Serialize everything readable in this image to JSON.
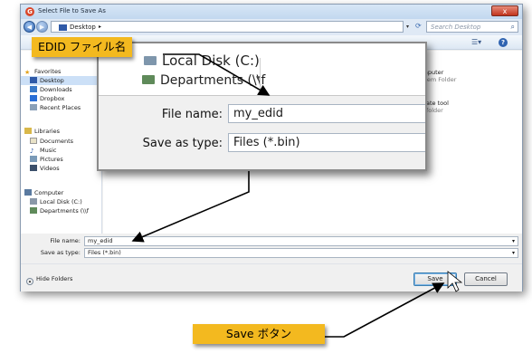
{
  "window": {
    "title": "Select File to Save As",
    "close_glyph": "x",
    "app_icon_glyph": "G"
  },
  "address": {
    "path": "Desktop",
    "search_placeholder": "Search Desktop"
  },
  "nav": {
    "favorites_label": "Favorites",
    "items": [
      {
        "label": "Desktop",
        "icon": "desktop-icon",
        "selected": true
      },
      {
        "label": "Downloads",
        "icon": "downloads-icon"
      },
      {
        "label": "Dropbox",
        "icon": "dropbox-icon"
      },
      {
        "label": "Recent Places",
        "icon": "recent-places-icon"
      }
    ],
    "libraries_label": "Libraries",
    "library_items": [
      {
        "label": "Documents"
      },
      {
        "label": "Music"
      },
      {
        "label": "Pictures"
      },
      {
        "label": "Videos"
      }
    ],
    "computer_label": "Computer",
    "computer_items": [
      {
        "label": "Local Disk (C:)"
      },
      {
        "label": "Departments (\\\\f"
      }
    ]
  },
  "files": [
    {
      "name": "Computer",
      "sub": "System Folder"
    },
    {
      "name": "Update tool",
      "sub": "File folder"
    }
  ],
  "form": {
    "filename_label": "File name:",
    "filename_value": "my_edid",
    "savetype_label": "Save as type:",
    "savetype_value": "Files (*.bin)"
  },
  "footer": {
    "hide_folders": "Hide Folders",
    "save": "Save",
    "cancel": "Cancel"
  },
  "zoom": {
    "drive_c": "Local Disk (C:)",
    "departments": "Departments (\\\\f",
    "filename_label": "File name:",
    "filename_value": "my_edid",
    "savetype_label": "Save as type:",
    "savetype_value": "Files (*.bin)"
  },
  "annotations": {
    "edid_filename": "EDID ファイル名",
    "save_button": "Save ボタン"
  },
  "colors": {
    "callout": "#f3b91f",
    "arrow": "#000000"
  }
}
